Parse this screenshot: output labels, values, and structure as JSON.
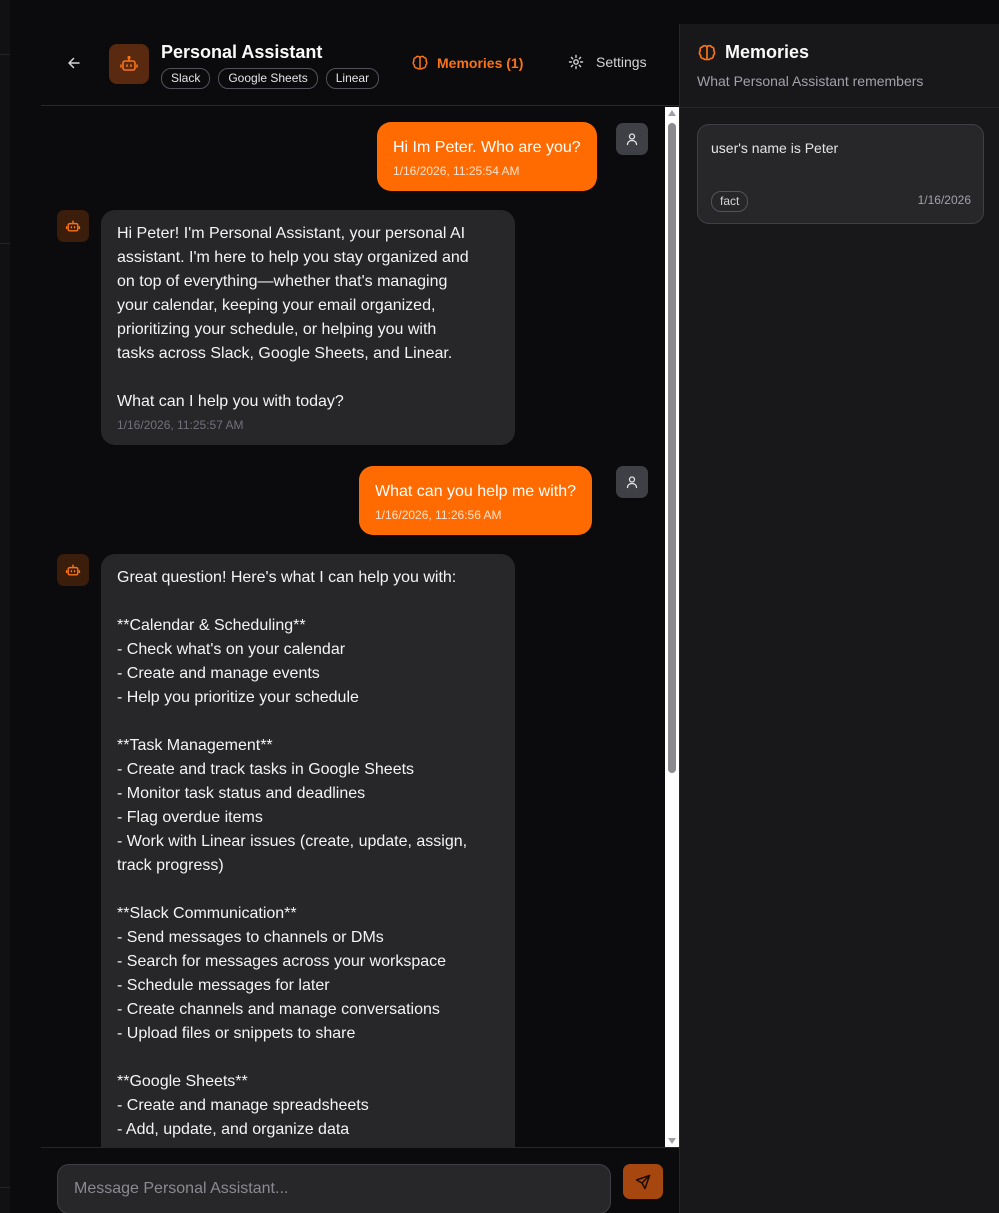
{
  "header": {
    "title": "Personal Assistant",
    "tools": [
      "Slack",
      "Google Sheets",
      "Linear"
    ],
    "memories_label": "Memories (1)",
    "settings_label": "Settings"
  },
  "messages": [
    {
      "role": "user",
      "text": "Hi Im Peter. Who are you?",
      "timestamp": "1/16/2026, 11:25:54 AM"
    },
    {
      "role": "assistant",
      "text": "Hi Peter! I'm Personal Assistant, your personal AI\nassistant. I'm here to help you stay organized and\non top of everything—whether that's managing\nyour calendar, keeping your email organized,\nprioritizing your schedule, or helping you with\ntasks across Slack, Google Sheets, and Linear.\n\nWhat can I help you with today?",
      "timestamp": "1/16/2026, 11:25:57 AM"
    },
    {
      "role": "user",
      "text": "What can you help me with?",
      "timestamp": "1/16/2026, 11:26:56 AM"
    },
    {
      "role": "assistant",
      "text": "Great question! Here's what I can help you with:\n\n**Calendar & Scheduling**\n- Check what's on your calendar\n- Create and manage events\n- Help you prioritize your schedule\n\n**Task Management**\n- Create and track tasks in Google Sheets\n- Monitor task status and deadlines\n- Flag overdue items\n- Work with Linear issues (create, update, assign,\ntrack progress)\n\n**Slack Communication**\n- Send messages to channels or DMs\n- Search for messages across your workspace\n- Schedule messages for later\n- Create channels and manage conversations\n- Upload files or snippets to share\n\n**Google Sheets**\n- Create and manage spreadsheets\n- Add, update, and organize data",
      "timestamp": ""
    }
  ],
  "composer": {
    "placeholder": "Message Personal Assistant..."
  },
  "memories_panel": {
    "title": "Memories",
    "subtitle": "What Personal Assistant remembers",
    "items": [
      {
        "content": "user's name is Peter",
        "tag": "fact",
        "date": "1/16/2026"
      }
    ]
  },
  "colors": {
    "accent": "#ff6b00",
    "background": "#0b0b0d",
    "bubble_assistant": "#27272a",
    "panel": "#18181b"
  },
  "icons": {
    "back": "arrow-left-icon",
    "agent": "robot-icon",
    "memories": "brain-icon",
    "settings": "gear-icon",
    "user": "user-icon",
    "send": "send-icon"
  }
}
